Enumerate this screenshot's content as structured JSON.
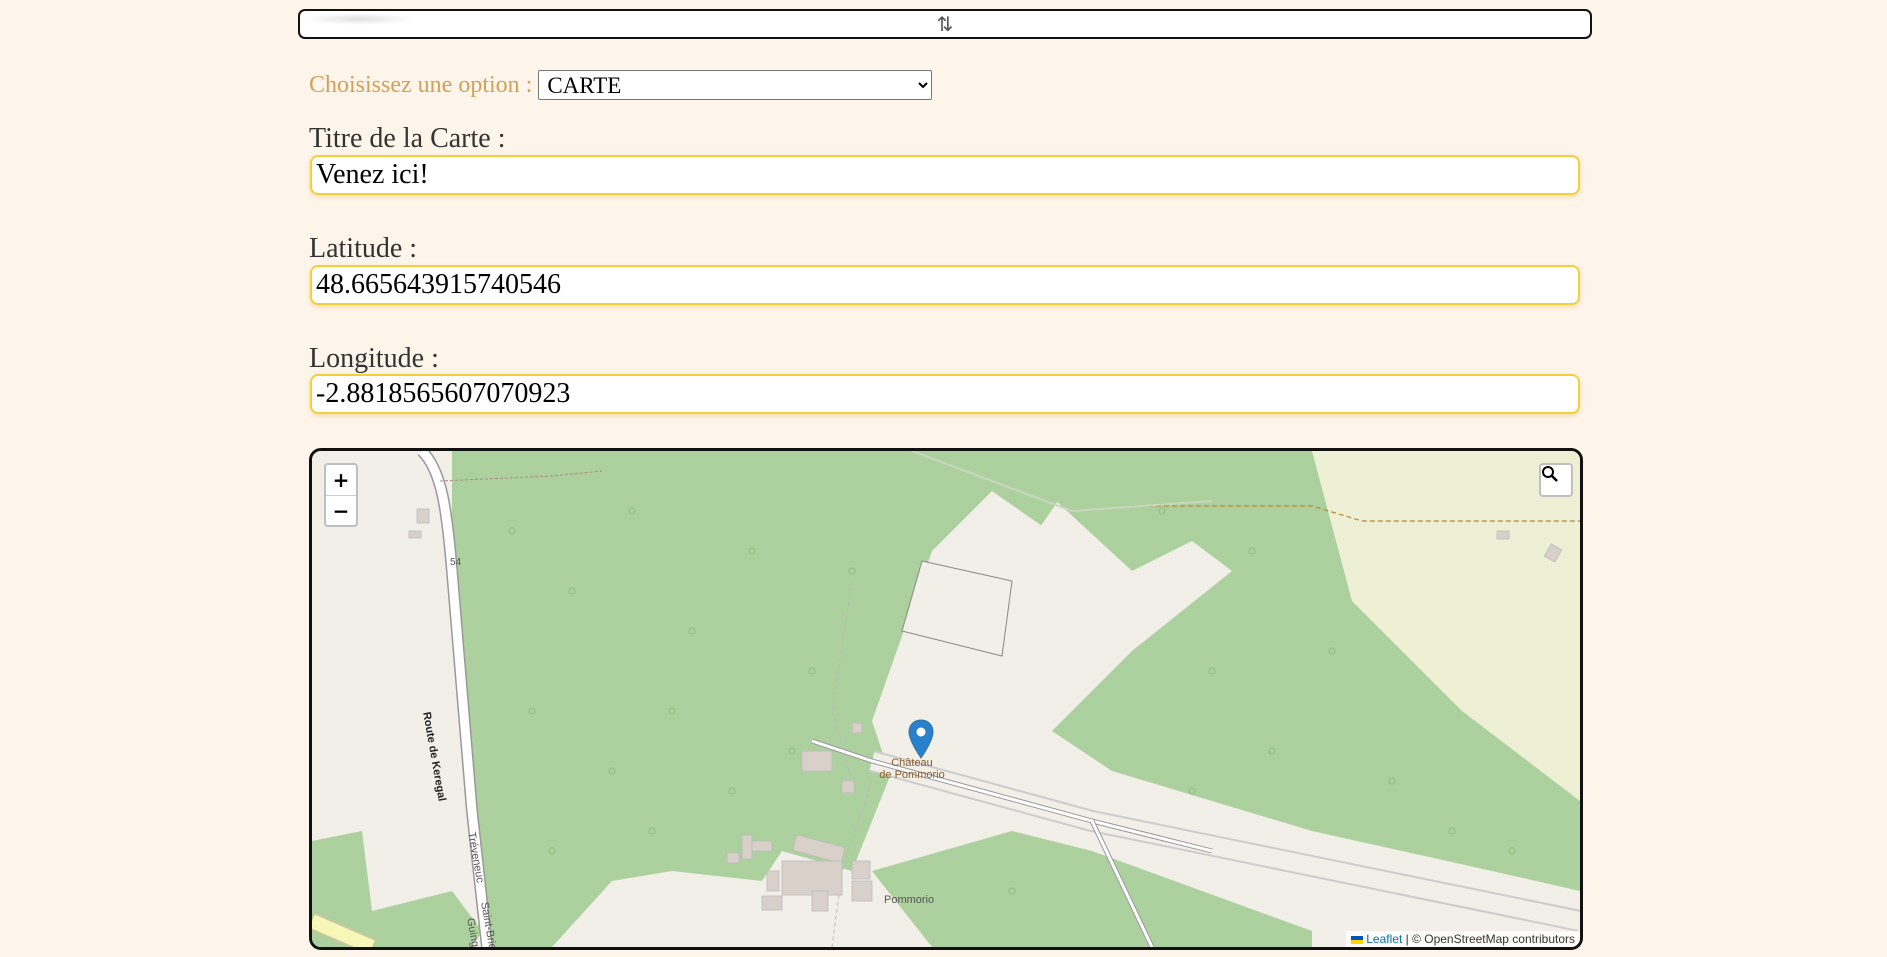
{
  "toggle": {
    "icon": "up-down-arrows-icon",
    "symbol": "⇅"
  },
  "option": {
    "label": "Choisissez une option :",
    "selected": "CARTE"
  },
  "fields": {
    "title_label": "Titre de la Carte :",
    "title_value": "Venez ici!",
    "latitude_label": "Latitude :",
    "latitude_value": "48.665643915740546",
    "longitude_label": "Longitude :",
    "longitude_value": "-2.8818565607070923"
  },
  "map": {
    "zoom_in": "+",
    "zoom_out": "−",
    "search_icon": "magnifier-icon",
    "marker_icon": "map-pin-icon",
    "poi_name_line1": "Château",
    "poi_name_line2": "de Pommorio",
    "place_label": "Pommorio",
    "road_label": "Route de Keregal",
    "road_label_2": "Tréveneuc",
    "road_label_3": "Saint-Brieuc",
    "road_label_4": "Guingamp",
    "road_number": "54",
    "attribution_link": "Leaflet",
    "attribution_text": "| © OpenStreetMap contributors",
    "colors": {
      "forest": "#add19e",
      "ground": "#f2efe9",
      "farmland": "#eef0d5",
      "marker": "#2a81cb",
      "field_border": "#f3d03a",
      "option_label": "#d3a05a"
    }
  }
}
